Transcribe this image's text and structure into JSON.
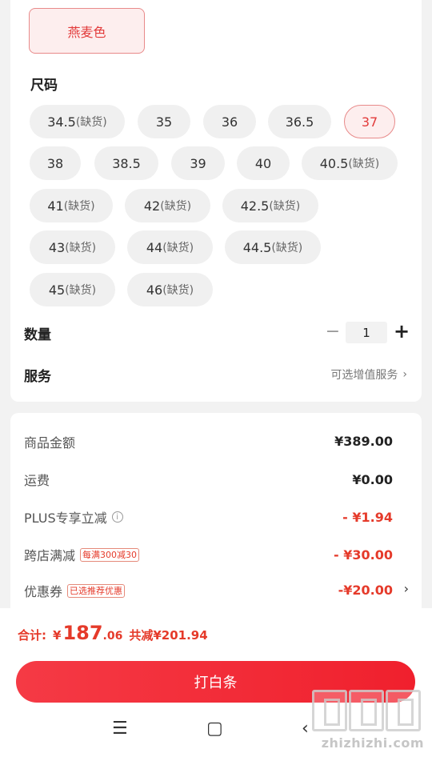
{
  "color_option": "燕麦色",
  "size": {
    "title": "尺码",
    "options": [
      {
        "value": "34.5",
        "note": "(缺货)"
      },
      {
        "value": "35",
        "note": ""
      },
      {
        "value": "36",
        "note": ""
      },
      {
        "value": "36.5",
        "note": ""
      },
      {
        "value": "37",
        "note": ""
      },
      {
        "value": "38",
        "note": ""
      },
      {
        "value": "38.5",
        "note": ""
      },
      {
        "value": "39",
        "note": ""
      },
      {
        "value": "40",
        "note": ""
      },
      {
        "value": "40.5",
        "note": "(缺货)"
      },
      {
        "value": "41",
        "note": "(缺货)"
      },
      {
        "value": "42",
        "note": "(缺货)"
      },
      {
        "value": "42.5",
        "note": "(缺货)"
      },
      {
        "value": "43",
        "note": "(缺货)"
      },
      {
        "value": "44",
        "note": "(缺货)"
      },
      {
        "value": "44.5",
        "note": "(缺货)"
      },
      {
        "value": "45",
        "note": "(缺货)"
      },
      {
        "value": "46",
        "note": "(缺货)"
      }
    ],
    "selected": "37"
  },
  "quantity": {
    "label": "数量",
    "value": "1",
    "minus": "−",
    "plus": "+"
  },
  "service": {
    "label": "服务",
    "value": "可选增值服务",
    "chevron": "›"
  },
  "summary": {
    "goods_label": "商品金额",
    "goods_value": "¥389.00",
    "shipping_label": "运费",
    "shipping_value": "¥0.00",
    "plus_label": "PLUS专享立减",
    "plus_info": "i",
    "plus_value": "- ¥1.94",
    "cross_label": "跨店满减",
    "cross_tag": "每满300减30",
    "cross_value": "- ¥30.00",
    "coupon_label": "优惠券",
    "coupon_tag": "已选推荐优惠",
    "coupon_value": "-¥20.00",
    "coupon_chevron": "›"
  },
  "total": {
    "label": "合计:",
    "currency": "¥",
    "integer": "187",
    "decimal": ".06",
    "savings": "共减¥201.94"
  },
  "pay_button": "打白条",
  "nav": {
    "menu": "☰",
    "home": "▢",
    "back": "‹"
  },
  "watermark": "zhizhizhi.com",
  "colors": {
    "accent": "#e53a2a",
    "button": "#f0202d",
    "chip_selected_bg": "#fdeeee"
  }
}
